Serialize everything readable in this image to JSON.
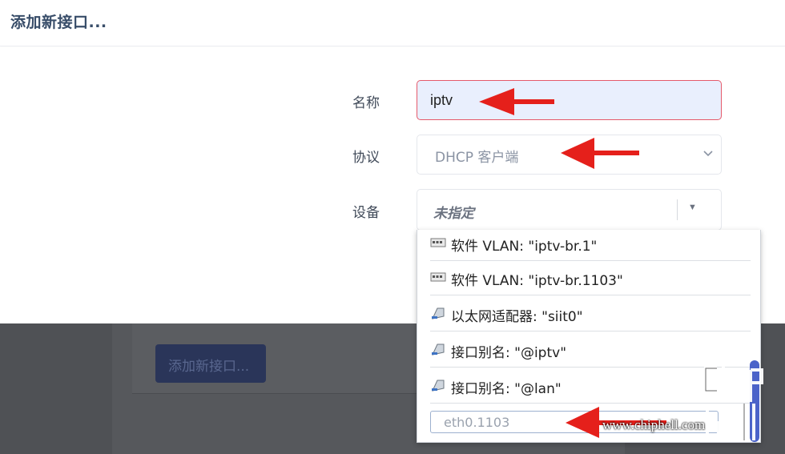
{
  "dialog": {
    "title": "添加新接口..."
  },
  "form": {
    "name_label": "名称",
    "name_value": "iptv",
    "protocol_label": "协议",
    "protocol_value": "DHCP 客户端",
    "device_label": "设备",
    "device_value": "未指定"
  },
  "dropdown": {
    "items": [
      {
        "icon": "switch-icon",
        "label": "软件 VLAN: \"iptv-br.1\""
      },
      {
        "icon": "switch-icon",
        "label": "软件 VLAN: \"iptv-br.1103\""
      },
      {
        "icon": "ethernet-icon",
        "label": "以太网适配器: \"siit0\""
      },
      {
        "icon": "ethernet-icon",
        "label": "接口别名: \"@iptv\""
      },
      {
        "icon": "ethernet-icon",
        "label": "接口别名: \"@lan\""
      }
    ],
    "filter_value": "eth0.1103"
  },
  "background": {
    "add_button_label": "添加新接口..."
  },
  "watermark": {
    "text": "www.chiphell.com",
    "logo_text": "chiphell"
  },
  "colors": {
    "annotation_arrow": "#e5201b",
    "scrollbar": "#4b63c9",
    "name_border": "#e55a6a"
  }
}
